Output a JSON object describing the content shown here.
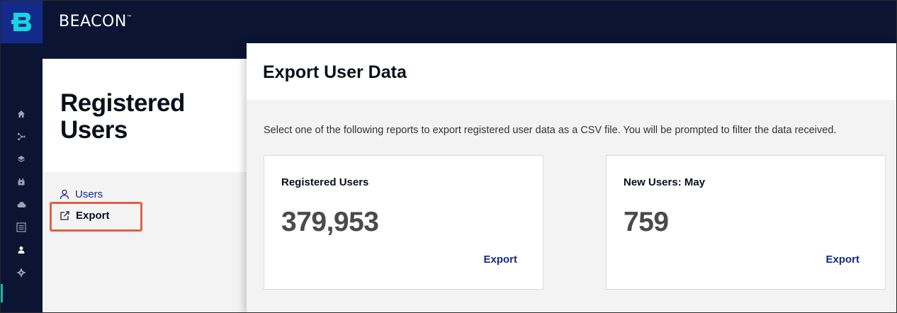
{
  "app": {
    "brand": "BEACON",
    "trademark": "™"
  },
  "rail": {
    "icons": [
      "home-icon",
      "flow-icon",
      "layers-icon",
      "device-icon",
      "cloud-icon",
      "list-icon",
      "user-icon",
      "gear-icon"
    ],
    "active": "user-icon",
    "accent_color": "#1fb5a5"
  },
  "left_panel": {
    "title": "Registered Users",
    "nav": [
      {
        "label": "Users",
        "icon": "user-outline-icon"
      },
      {
        "label": "Export",
        "icon": "external-link-icon",
        "selected": true
      }
    ]
  },
  "modal": {
    "title": "Export User Data",
    "description": "Select one of the following reports to export registered user data as a CSV file. You will be prompted to filter the data received.",
    "cards": [
      {
        "title": "Registered Users",
        "value": "379,953",
        "action": "Export"
      },
      {
        "title": "New Users: May",
        "value": "759",
        "action": "Export"
      }
    ]
  },
  "colors": {
    "topbar_bg": "#0b1533",
    "logo_bg": "#132a8a",
    "link": "#132a8a",
    "highlight": "#e0604a"
  }
}
